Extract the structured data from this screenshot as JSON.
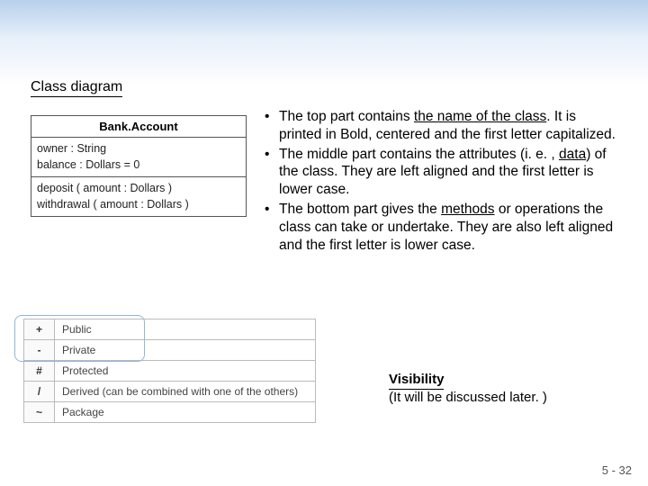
{
  "title": "Class diagram",
  "uml": {
    "name": "Bank.Account",
    "attrs": [
      "owner : String",
      "balance : Dollars = 0"
    ],
    "ops": [
      "deposit ( amount : Dollars )",
      "withdrawal ( amount : Dollars )"
    ]
  },
  "bullets": [
    {
      "pre": "The top part contains ",
      "u": "the name of the class",
      "post": ". It is printed in Bold, centered and the first letter capitalized."
    },
    {
      "pre": "The middle part contains the attributes (i. e. , ",
      "u": "data",
      "post": ") of the class. They are left aligned and the first letter is lower case."
    },
    {
      "pre": "The bottom part gives the ",
      "u": "methods",
      "post": " or operations the class can take or undertake. They are also left aligned and the first letter is lower case."
    }
  ],
  "visibility": {
    "rows": [
      {
        "sym": "+",
        "label": "Public"
      },
      {
        "sym": "-",
        "label": "Private"
      },
      {
        "sym": "#",
        "label": "Protected"
      },
      {
        "sym": "/",
        "label": "Derived (can be combined with one of the others)"
      },
      {
        "sym": "~",
        "label": "Package"
      }
    ],
    "heading": "Visibility",
    "note": "(It will be discussed later. )"
  },
  "page_number": "5 - 32"
}
